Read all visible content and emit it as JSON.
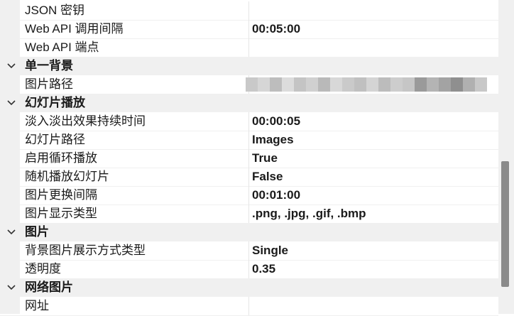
{
  "rows": [
    {
      "type": "prop",
      "name": "JSON 密钥",
      "value": ""
    },
    {
      "type": "prop",
      "name": "Web API 调用间隔",
      "value": "00:05:00"
    },
    {
      "type": "prop",
      "name": "Web API 端点",
      "value": ""
    },
    {
      "type": "cat",
      "name": "单一背景"
    },
    {
      "type": "prop",
      "name": "图片路径",
      "value": "",
      "blurred": true
    },
    {
      "type": "cat",
      "name": "幻灯片播放"
    },
    {
      "type": "prop",
      "name": "淡入淡出效果持续时间",
      "value": "00:00:05"
    },
    {
      "type": "prop",
      "name": "幻灯片路径",
      "value": "Images"
    },
    {
      "type": "prop",
      "name": "启用循环播放",
      "value": "True"
    },
    {
      "type": "prop",
      "name": "随机播放幻灯片",
      "value": "False"
    },
    {
      "type": "prop",
      "name": "图片更换间隔",
      "value": "00:01:00"
    },
    {
      "type": "prop",
      "name": "图片显示类型",
      "value": ".png, .jpg, .gif, .bmp"
    },
    {
      "type": "cat",
      "name": "图片"
    },
    {
      "type": "prop",
      "name": "背景图片展示方式类型",
      "value": "Single"
    },
    {
      "type": "prop",
      "name": "透明度",
      "value": "0.35"
    },
    {
      "type": "cat",
      "name": "网络图片"
    },
    {
      "type": "prop",
      "name": "网址",
      "value": ""
    }
  ],
  "colors": {
    "category_bg": "#f0f0f0",
    "scroll_thumb": "#8a8a8a"
  },
  "icons": {
    "category_toggle": "chevron-down-icon"
  }
}
